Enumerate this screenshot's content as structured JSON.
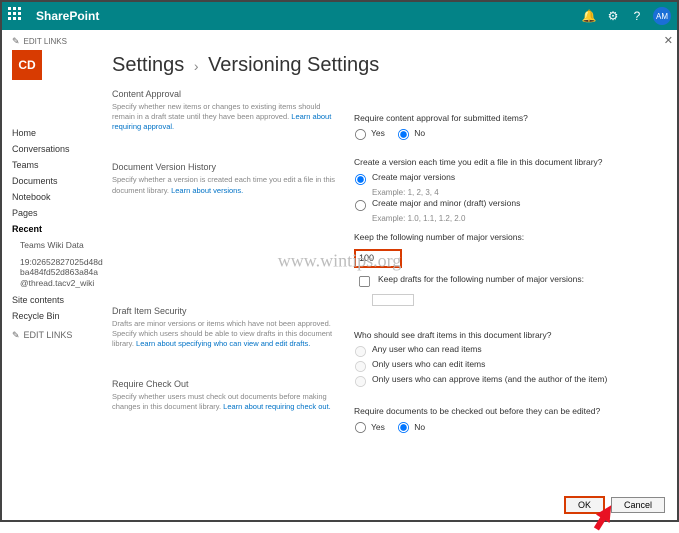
{
  "suitebar": {
    "brand": "SharePoint",
    "avatar_initials": "AM"
  },
  "tile_initials": "CD",
  "edit_links_label": "EDIT LINKS",
  "breadcrumb": {
    "parent": "Settings",
    "current": "Versioning Settings"
  },
  "nav": {
    "items": [
      "Home",
      "Conversations",
      "Teams",
      "Documents",
      "Notebook",
      "Pages",
      "Recent"
    ],
    "recent_children": [
      "Teams Wiki Data",
      "19:02652827025d48dba484fd52d863a84a@thread.tacv2_wiki"
    ],
    "tail": [
      "Site contents",
      "Recycle Bin"
    ],
    "edit_links": "EDIT LINKS"
  },
  "desc": {
    "approval": {
      "title": "Content Approval",
      "text": "Specify whether new items or changes to existing items should remain in a draft state until they have been approved.  ",
      "link": "Learn about requiring approval."
    },
    "versions": {
      "title": "Document Version History",
      "text": "Specify whether a version is created each time you edit a file in this document library.  ",
      "link": "Learn about versions."
    },
    "draftsec": {
      "title": "Draft Item Security",
      "text": "Drafts are minor versions or items which have not been approved. Specify which users should be able to view drafts in this document library.  ",
      "link": "Learn about specifying who can view and edit drafts."
    },
    "checkout": {
      "title": "Require Check Out",
      "text": "Specify whether users must check out documents before making changes in this document library.  ",
      "link": "Learn about requiring check out."
    }
  },
  "opts": {
    "approval_q": "Require content approval for submitted items?",
    "yes": "Yes",
    "no": "No",
    "version_q": "Create a version each time you edit a file in this document library?",
    "major_label": "Create major versions",
    "major_example": "Example: 1, 2, 3, 4",
    "minor_label": "Create major and minor (draft) versions",
    "minor_example": "Example: 1.0, 1.1, 1.2, 2.0",
    "keep_major_q": "Keep the following number of major versions:",
    "keep_major_value": "100",
    "keep_drafts_label": "Keep drafts for the following number of major versions:",
    "draft_vis_q": "Who should see draft items in this document library?",
    "draft_opt1": "Any user who can read items",
    "draft_opt2": "Only users who can edit items",
    "draft_opt3": "Only users who can approve items (and the author of the item)",
    "checkout_q": "Require documents to be checked out before they can be edited?"
  },
  "buttons": {
    "ok": "OK",
    "cancel": "Cancel"
  },
  "watermark": "www.wintips.org"
}
